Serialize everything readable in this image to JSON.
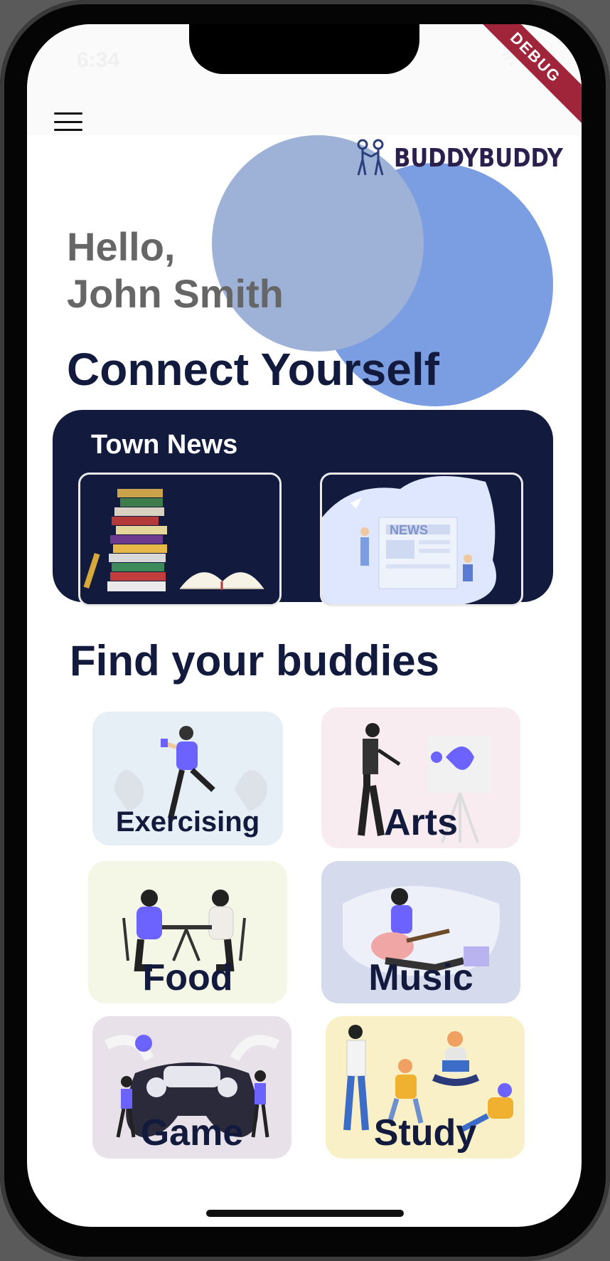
{
  "status": {
    "time": "6:34"
  },
  "debug_banner": "DEBUG",
  "app": {
    "logo_text": "BUDDYBUDDY"
  },
  "greeting": {
    "line1": "Hello,",
    "line2": "John Smith"
  },
  "headline": "Connect Yourself",
  "news": {
    "title": "Town News",
    "images": [
      "books-illustration",
      "news-illustration"
    ],
    "image_caption": "NEWS"
  },
  "buddies": {
    "title": "Find your buddies",
    "categories": [
      {
        "label": "Exercising",
        "bg": "#e6eef6"
      },
      {
        "label": "Arts",
        "bg": "#f8ecf1"
      },
      {
        "label": "Food",
        "bg": "#f4f6e6"
      },
      {
        "label": "Music",
        "bg": "#d5daec"
      },
      {
        "label": "Game",
        "bg": "#e9e1ea"
      },
      {
        "label": "Study",
        "bg": "#faf0c8"
      }
    ]
  },
  "colors": {
    "navy": "#121b3d",
    "accent_blue": "#7b9de2",
    "light_blue": "#9db2d6",
    "debug_red": "#a0253a"
  }
}
